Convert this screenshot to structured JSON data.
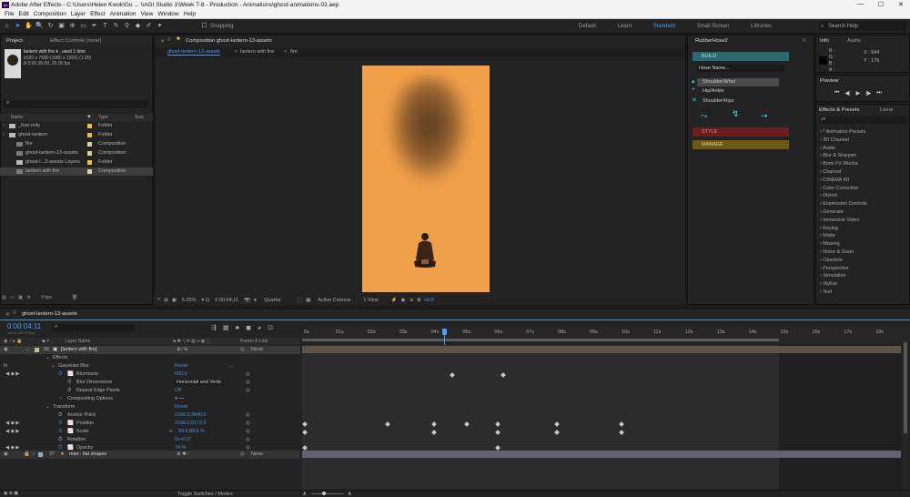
{
  "window": {
    "title": "Adobe After Effects - C:\\Users\\Helen Kwok\\Go ... \\\\AGI Studio 1\\Week 7-8 - Production - Animations\\ghost-animations-03.aep",
    "minimize": "—",
    "maximize": "☐",
    "close": "✕"
  },
  "menu": [
    "File",
    "Edit",
    "Composition",
    "Layer",
    "Effect",
    "Animation",
    "View",
    "Window",
    "Help"
  ],
  "toolbar": {
    "snapping": "Snapping",
    "workspaces": [
      "Default",
      "Learn",
      "Standard",
      "Small Screen",
      "Libraries"
    ],
    "active_workspace": "Standard",
    "search_placeholder": "Search Help"
  },
  "project": {
    "tabs": [
      "Project",
      "Effect Controls (none)"
    ],
    "selected_name": "lantern with fire ▾ , used 1 time",
    "meta_line1": "4320 x 7680  (1080 x 1920) (1.00)",
    "meta_line2": "Δ 0:00:30:00, 25.00 fps",
    "columns": {
      "name": "Name",
      "type": "Type",
      "size": "Size"
    },
    "items": [
      {
        "name": "_fest-only",
        "type": "Folder",
        "indent": 0,
        "kind": "folder",
        "color": "#e1c63a"
      },
      {
        "name": "ghost-lantern",
        "type": "Folder",
        "indent": 0,
        "kind": "folder",
        "color": "#e1c63a"
      },
      {
        "name": "fire",
        "type": "Composition",
        "indent": 1,
        "kind": "comp",
        "color": "#d8d0a0"
      },
      {
        "name": "ghost-lantern-13-assets",
        "type": "Composition",
        "indent": 1,
        "kind": "comp",
        "color": "#d8d0a0"
      },
      {
        "name": "ghost-l...3-assets Layers",
        "type": "Folder",
        "indent": 1,
        "kind": "folder",
        "color": "#e1c63a"
      },
      {
        "name": "lantern with fire",
        "type": "Composition",
        "indent": 1,
        "kind": "comp",
        "color": "#d8d0a0",
        "selected": true
      }
    ],
    "bpc": "8 bpc"
  },
  "composition": {
    "tab": "Composition ghost-lantern-13-assets",
    "breadcrumb": [
      "ghost-lantern-13-assets",
      "lantern with fire",
      "fire"
    ],
    "zoom": "6.25%",
    "timecode": "0:00:04:11",
    "resolution": "Quarter",
    "camera": "Active Camera",
    "views": "1 View",
    "exposure": "+0.0"
  },
  "rubberhose": {
    "title": "RubberHose2",
    "build": "BUILD",
    "hose_name_placeholder": "Hose Name...",
    "hoses": [
      "Shoulder/Wrist",
      "Hip/Ankle",
      "Shoulder/Hips"
    ],
    "style": "STYLE",
    "manage": "MANAGE"
  },
  "info": {
    "tabs": [
      "Info",
      "Audio"
    ],
    "r": "R :",
    "g": "G :",
    "b": "B :",
    "a": "A :",
    "x": "X : 544",
    "y": "Y : 176"
  },
  "preview": {
    "title": "Preview"
  },
  "effects": {
    "tabs": [
      "Effects & Presets",
      "Librar"
    ],
    "search_placeholder": "ρ▾",
    "items": [
      "* Animation Presets",
      "3D Channel",
      "Audio",
      "Blur & Sharpen",
      "Boris FX Mocha",
      "Channel",
      "CINEMA 4D",
      "Color Correction",
      "Distort",
      "Expression Controls",
      "Generate",
      "Immersive Video",
      "Keying",
      "Matte",
      "Missing",
      "Noise & Grain",
      "Obsolete",
      "Perspective",
      "Simulation",
      "Stylize",
      "Text"
    ]
  },
  "timeline": {
    "tab": "ghost-lantern-13-assets",
    "timecode": "0:00:04:11",
    "frames": "00111 (25.00 fps)",
    "columns": {
      "layer_name": "Layer Name",
      "parent": "Parent & Link"
    },
    "ruler": [
      "0s",
      "01s",
      "02s",
      "03s",
      "04s",
      "05s",
      "06s",
      "07s",
      "08s",
      "09s",
      "10s",
      "11s",
      "12s",
      "13s",
      "14s",
      "15s",
      "16s",
      "17s",
      "18s"
    ],
    "layers": [
      {
        "num": "36",
        "name": "[lantern with fire]",
        "parent": "None"
      },
      {
        "num": "37",
        "name": "man : flat shapes",
        "parent": "None"
      }
    ],
    "props": {
      "effects": "Effects",
      "gaussian_blur": "Gaussian Blur",
      "reset": "Reset",
      "dots": "...",
      "blurriness": "Blurriness",
      "blurriness_val": "600.0",
      "blur_dimensions": "Blur Dimensions",
      "blur_dimensions_val": "Horizontal and Vertic",
      "repeat_edge": "Repeat Edge Pixels",
      "repeat_edge_val": "Off",
      "compositing": "Compositing Options",
      "compositing_val": "+ —",
      "transform": "Transform",
      "anchor": "Anchor Point",
      "anchor_val": "2160.0,3840.0",
      "position": "Position",
      "position_val": "2199.0,5173.5",
      "scale": "Scale",
      "scale_val": "89.6,89.6 %",
      "rotation": "Rotation",
      "rotation_val": "0x+0.0°",
      "opacity": "Opacity",
      "opacity_val": "74 %"
    },
    "toggle_label": "Toggle Switches / Modes"
  }
}
